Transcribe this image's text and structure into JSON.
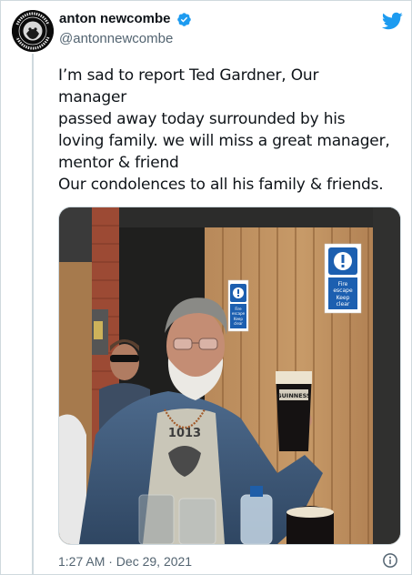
{
  "tweet": {
    "display_name": "anton newcombe",
    "handle": "@antonnewcombe",
    "verified_icon": "verified-badge-icon",
    "brand_icon": "twitter-bird-icon",
    "accent_color": "#1d9bf0",
    "text_lines": [
      "I’m sad to report Ted Gardner, Our",
      "manager",
      "passed away today surrounded by his",
      "loving family. we will miss a great manager,",
      "mentor & friend",
      "Our condolences to all his family & friends."
    ],
    "timestamp": "1:27 AM · Dec 29, 2021",
    "info_icon": "info-icon"
  },
  "photo": {
    "signs": {
      "left": [
        "Fire",
        "escape",
        "Keep",
        "clear"
      ],
      "right": [
        "Fire",
        "escape",
        "Keep",
        "clear"
      ]
    },
    "glass_brand": "GUINNESS",
    "shirt_text": "1013"
  },
  "avatar": {
    "ring_text": "BRIAN JONESTOWN MASSACRE"
  }
}
